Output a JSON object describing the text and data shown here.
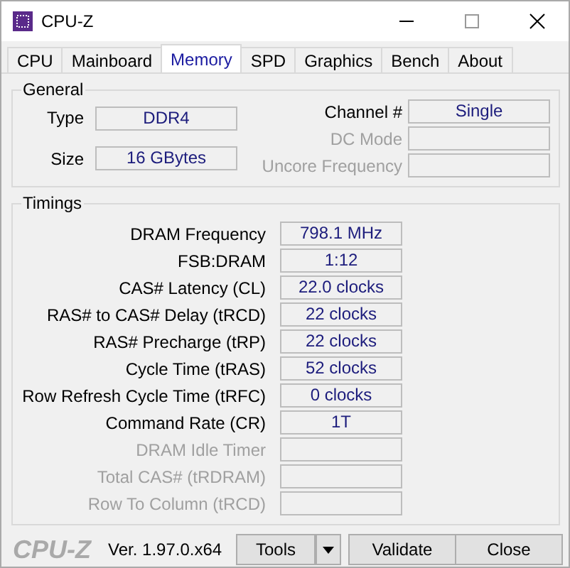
{
  "window": {
    "title": "CPU-Z"
  },
  "tabs": [
    {
      "label": "CPU",
      "selected": false
    },
    {
      "label": "Mainboard",
      "selected": false
    },
    {
      "label": "Memory",
      "selected": true
    },
    {
      "label": "SPD",
      "selected": false
    },
    {
      "label": "Graphics",
      "selected": false
    },
    {
      "label": "Bench",
      "selected": false
    },
    {
      "label": "About",
      "selected": false
    }
  ],
  "general": {
    "title": "General",
    "left": [
      {
        "label": "Type",
        "value": "DDR4",
        "disabled": false
      },
      {
        "label": "Size",
        "value": "16 GBytes",
        "disabled": false
      }
    ],
    "right": [
      {
        "label": "Channel #",
        "value": "Single",
        "disabled": false
      },
      {
        "label": "DC Mode",
        "disabled": true
      },
      {
        "label": "Uncore Frequency",
        "disabled": true
      }
    ]
  },
  "timings": {
    "title": "Timings",
    "rows": [
      {
        "label": "DRAM Frequency",
        "value": "798.1 MHz",
        "disabled": false
      },
      {
        "label": "FSB:DRAM",
        "value": "1:12",
        "disabled": false
      },
      {
        "label": "CAS# Latency (CL)",
        "value": "22.0 clocks",
        "disabled": false
      },
      {
        "label": "RAS# to CAS# Delay (tRCD)",
        "value": "22 clocks",
        "disabled": false
      },
      {
        "label": "RAS# Precharge (tRP)",
        "value": "22 clocks",
        "disabled": false
      },
      {
        "label": "Cycle Time (tRAS)",
        "value": "52 clocks",
        "disabled": false
      },
      {
        "label": "Row Refresh Cycle Time (tRFC)",
        "value": "0 clocks",
        "disabled": false
      },
      {
        "label": "Command Rate (CR)",
        "value": "1T",
        "disabled": false
      },
      {
        "label": "DRAM Idle Timer",
        "disabled": true
      },
      {
        "label": "Total CAS# (tRDRAM)",
        "disabled": true
      },
      {
        "label": "Row To Column (tRCD)",
        "disabled": true
      }
    ]
  },
  "footer": {
    "brand": "CPU-Z",
    "version": "Ver. 1.97.0.x64",
    "buttons": [
      "Tools",
      "Validate",
      "Close"
    ]
  }
}
